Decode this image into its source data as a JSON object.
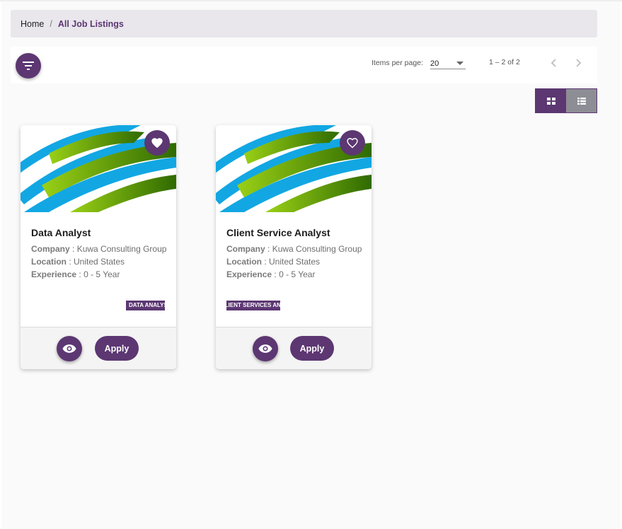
{
  "breadcrumb": {
    "home": "Home",
    "separator": "/",
    "current": "All Job Listings"
  },
  "toolbar": {
    "filter_icon": "filter-icon",
    "items_per_page_label": "Items per page:",
    "items_per_page_value": "20",
    "range_label": "1 – 2 of 2"
  },
  "view_toggle": {
    "active": "grid"
  },
  "colors": {
    "brand": "#5c3772",
    "breadcrumb_bg": "#e9e6ec"
  },
  "jobs": [
    {
      "title": "Data Analyst",
      "company_label": "Company",
      "company": "Kuwa Consulting Group",
      "location_label": "Location",
      "location": "United States",
      "experience_label": "Experience",
      "experience": "0 - 5 Year",
      "tag": "DATA ANALYST",
      "favorited": true,
      "apply_label": "Apply"
    },
    {
      "title": "Client Service Analyst",
      "company_label": "Company",
      "company": "Kuwa Consulting Group",
      "location_label": "Location",
      "location": "United States",
      "experience_label": "Experience",
      "experience": "0 - 5 Year",
      "tag": "CLIENT SERVICES ANALYST",
      "favorited": false,
      "apply_label": "Apply"
    }
  ]
}
